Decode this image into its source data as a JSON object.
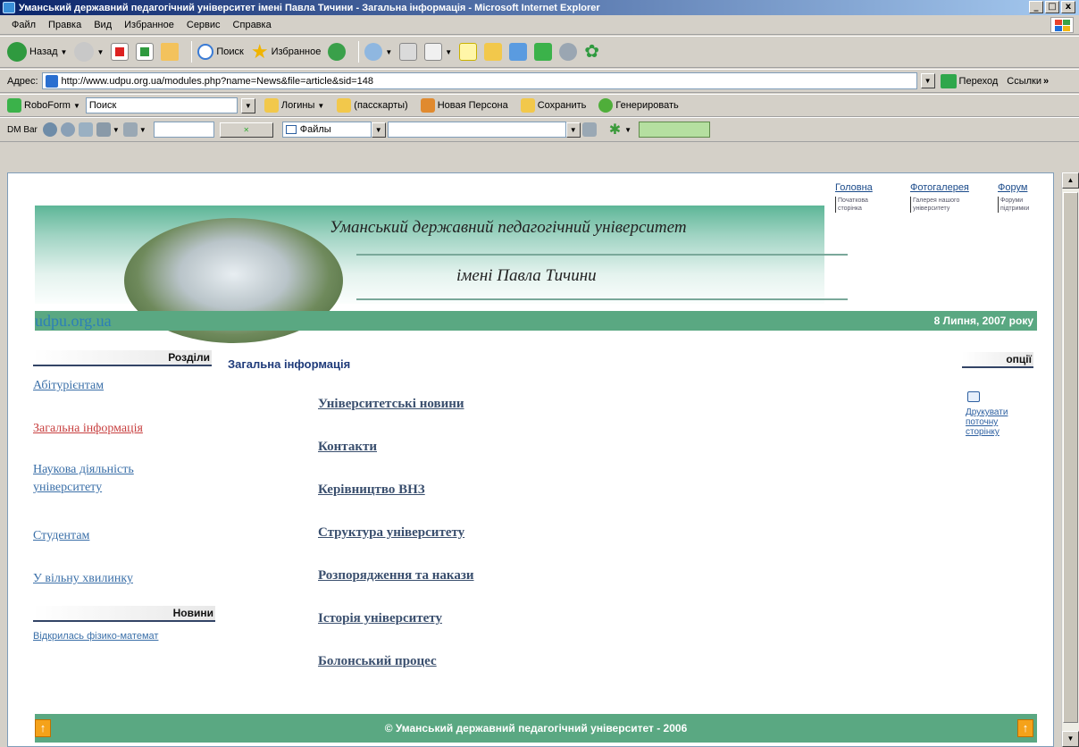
{
  "window": {
    "title": "Уманський державний педагогічний університет імені Павла Тичини - Загальна інформація - Microsoft Internet Explorer",
    "min": "_",
    "max": "□",
    "close": "x"
  },
  "menu": {
    "items": [
      "Файл",
      "Правка",
      "Вид",
      "Избранное",
      "Сервис",
      "Справка"
    ]
  },
  "toolbar": {
    "back_label": "Назад",
    "search_label": "Поиск",
    "favorites_label": "Избранное"
  },
  "address": {
    "label": "Адрес:",
    "url": "http://www.udpu.org.ua/modules.php?name=News&file=article&sid=148",
    "go_label": "Переход",
    "links_label": "Ссылки"
  },
  "roboform": {
    "name": "RoboForm",
    "search_placeholder": "Поиск",
    "logins": "Логины",
    "passcards": "(пасскарты)",
    "new_persona": "Новая Персона",
    "save": "Сохранить",
    "generate": "Генерировать"
  },
  "dmbar": {
    "name": "DM Bar",
    "files": "Файлы"
  },
  "page": {
    "banner_title": "Уманський державний педагогічний університет",
    "banner_sub": "імені Павла Тичини",
    "top_links": [
      {
        "label": "Головна",
        "sub": "Початкова сторінка"
      },
      {
        "label": "Фотогалерея",
        "sub": "Галерея нашого університету"
      },
      {
        "label": "Форум",
        "sub": "Форуми підтримки"
      }
    ],
    "site_name": "udpu.org.ua",
    "date": "8 Липня, 2007 року",
    "sections_title": "Розділи",
    "content_title": "Загальна інформація",
    "options_title": "опції",
    "left_links": [
      "Абітурієнтам",
      "Загальна інформація",
      "Наукова діяльність",
      "університету",
      "Студентам",
      "У вільну хвилинку"
    ],
    "news_title": "Новини",
    "news_link": "Відкрилась фізико-математ",
    "mid_links": [
      "Університетські новини",
      "Контакти",
      "Керівництво ВНЗ",
      "Структура університету",
      "Розпорядження та накази",
      "Історія університету",
      "Болонський процес"
    ],
    "print_link_1": "Друкувати",
    "print_link_2": "поточну",
    "print_link_3": "сторінку",
    "footer": "© Уманський державний педагогічний університет - 2006",
    "up_arrow": "↑"
  }
}
